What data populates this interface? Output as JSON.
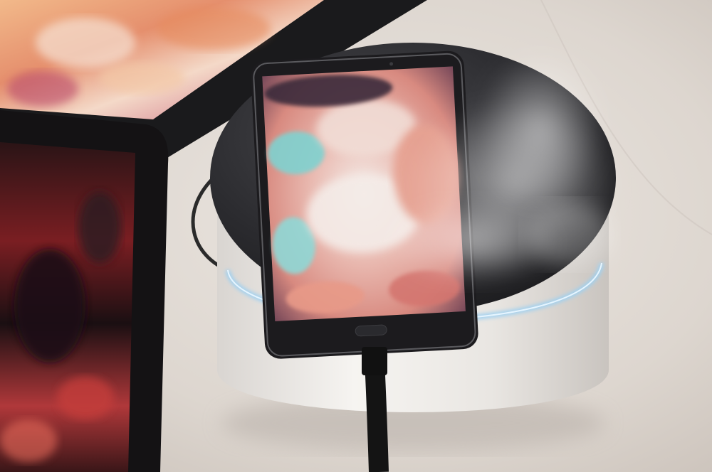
{
  "photo": {
    "subject": "smartphone-on-humidifier-display",
    "palette": {
      "floor": "#e2dcd6",
      "floor_shadow": "#c9c1ba",
      "device_body": "#1c1b1e",
      "pedestal": "#efece8",
      "pedestal_top": "#2a2a2d",
      "led_ring": "#9fd0f0",
      "cable": "#141414",
      "mist": "#f4f1ee",
      "screen_pink": "#e8a29a",
      "screen_teal": "#7fd2d0",
      "screen_white": "#f1e7e4",
      "screen_dark": "#3a2c3a",
      "tablet_red": "#b02a2a",
      "monitor_orange": "#e89a6a"
    }
  }
}
